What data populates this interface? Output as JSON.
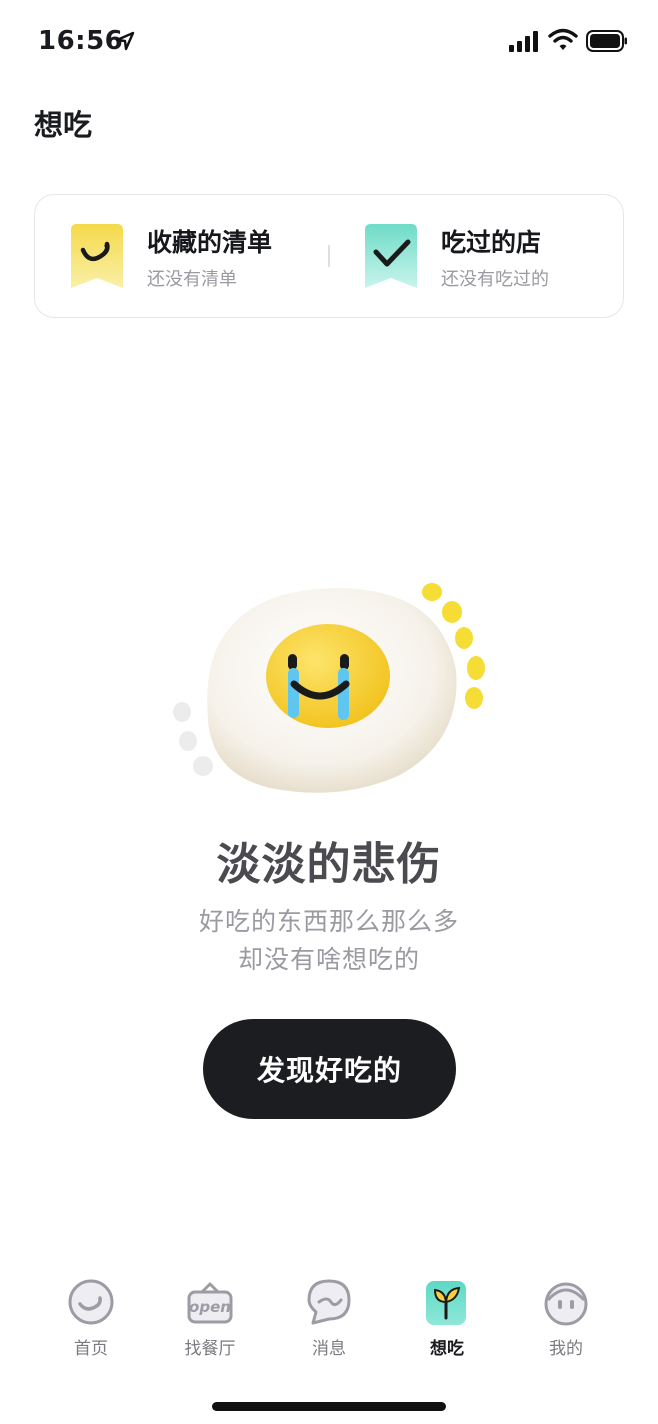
{
  "status_bar": {
    "time": "16:56"
  },
  "page": {
    "title": "想吃"
  },
  "card": {
    "saved_list": {
      "title": "收藏的清单",
      "subtitle": "还没有清单",
      "color": "#f5d94a"
    },
    "visited": {
      "title": "吃过的店",
      "subtitle": "还没有吃过的",
      "color": "#7fe0cf"
    }
  },
  "empty_state": {
    "title": "淡淡的悲伤",
    "line1": "好吃的东西那么那么多",
    "line2": "却没有啥想吃的",
    "button_label": "发现好吃的"
  },
  "tab_bar": {
    "items": [
      {
        "label": "首页",
        "icon": "home-face-icon",
        "active": false
      },
      {
        "label": "找餐厅",
        "icon": "open-sign-icon",
        "active": false
      },
      {
        "label": "消息",
        "icon": "message-bubble-icon",
        "active": false
      },
      {
        "label": "想吃",
        "icon": "sprout-icon",
        "active": true
      },
      {
        "label": "我的",
        "icon": "profile-face-icon",
        "active": false
      }
    ]
  },
  "colors": {
    "accent_dark": "#1c1d21",
    "muted_text": "#9a9aa2",
    "egg_yolk": "#f7d13c",
    "tear": "#5ec6f0"
  }
}
